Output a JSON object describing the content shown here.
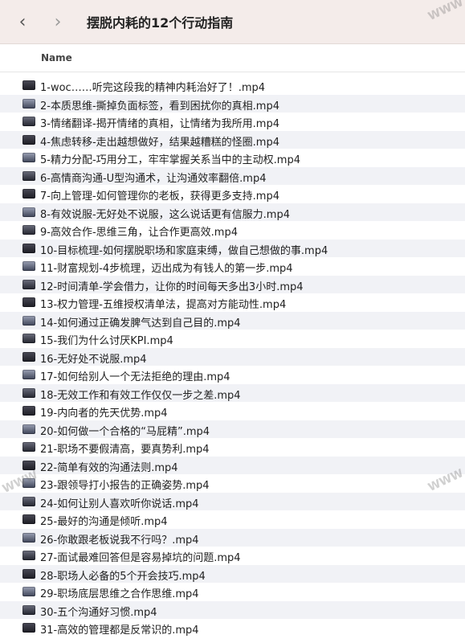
{
  "window": {
    "title": "摆脱内耗的12个行动指南",
    "back_icon": "chevron-left-icon",
    "forward_icon": "chevron-right-icon"
  },
  "columns": {
    "name": "Name"
  },
  "files": [
    "1-woc……听完这段我的精神内耗治好了！.mp4",
    "2-本质思维-撕掉负面标签，看到困扰你的真相.mp4",
    "3-情绪翻译-揭开情绪的真相，让情绪为我所用.mp4",
    "4-焦虑转移-走出越想做好，结果越糟糕的怪圈.mp4",
    "5-精力分配-巧用分工，牢牢掌握关系当中的主动权.mp4",
    "6-高情商沟通-U型沟通术，让沟通效率翻倍.mp4",
    "7-向上管理-如何管理你的老板，获得更多支持.mp4",
    "8-有效说服-无好处不说服，这么说话更有信服力.mp4",
    "9-高效合作-思维三角，让合作更高效.mp4",
    "10-目标梳理-如何摆脱职场和家庭束缚，做自己想做的事.mp4",
    "11-财富规划-4步梳理，迈出成为有钱人的第一步.mp4",
    "12-时间清单-学会借力，让你的时间每天多出3小时.mp4",
    "13-权力管理-五维授权清单法，提高对方能动性.mp4",
    "14-如何通过正确发脾气达到自己目的.mp4",
    "15-我们为什么讨厌KPI.mp4",
    "16-无好处不说服.mp4",
    "17-如何给别人一个无法拒绝的理由.mp4",
    "18-无效工作和有效工作仅仅一步之差.mp4",
    "19-内向者的先天优势.mp4",
    "20-如何做一个合格的“马屁精”.mp4",
    "21-职场不要假清高，要真势利.mp4",
    "22-简单有效的沟通法则.mp4",
    "23-跟领导打小报告的正确姿势.mp4",
    "24-如何让别人喜欢听你说话.mp4",
    "25-最好的沟通是倾听.mp4",
    "26-你敢跟老板说我不行吗？.mp4",
    "27-面试最难回答但是容易掉坑的问题.mp4",
    "28-职场人必备的5个开会技巧.mp4",
    "29-职场底层思维之合作思维.mp4",
    "30-五个沟通好习惯.mp4",
    "31-高效的管理都是反常识的.mp4"
  ]
}
